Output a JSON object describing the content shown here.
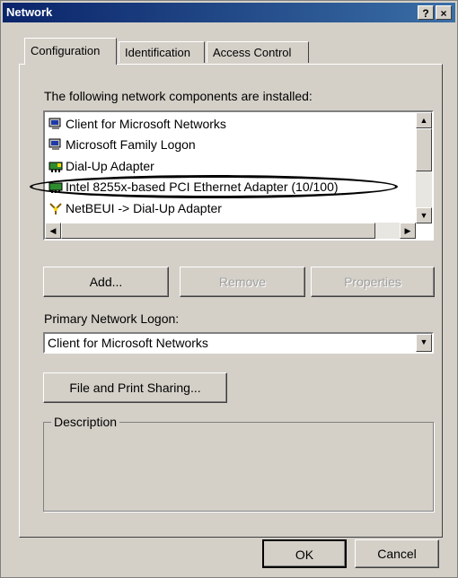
{
  "window": {
    "title": "Network",
    "help_glyph": "?",
    "close_glyph": "×"
  },
  "tabs": [
    {
      "label": "Configuration",
      "active": true
    },
    {
      "label": "Identification",
      "active": false
    },
    {
      "label": "Access Control",
      "active": false
    }
  ],
  "components": {
    "heading": "The following network components are installed:",
    "items": [
      {
        "label": "Client for Microsoft Networks",
        "icon": "network-client-icon"
      },
      {
        "label": "Microsoft Family Logon",
        "icon": "network-client-icon"
      },
      {
        "label": "Dial-Up Adapter",
        "icon": "adapter-card-icon"
      },
      {
        "label": "Intel 8255x-based PCI Ethernet Adapter (10/100)",
        "icon": "adapter-card-icon",
        "circled": true
      },
      {
        "label": "NetBEUI -> Dial-Up Adapter",
        "icon": "protocol-icon"
      }
    ]
  },
  "buttons": {
    "add": "Add...",
    "remove": "Remove",
    "properties": "Properties",
    "file_print": "File and Print Sharing...",
    "ok": "OK",
    "cancel": "Cancel"
  },
  "logon": {
    "label": "Primary Network Logon:",
    "value": "Client for Microsoft Networks"
  },
  "description": {
    "label": "Description"
  }
}
